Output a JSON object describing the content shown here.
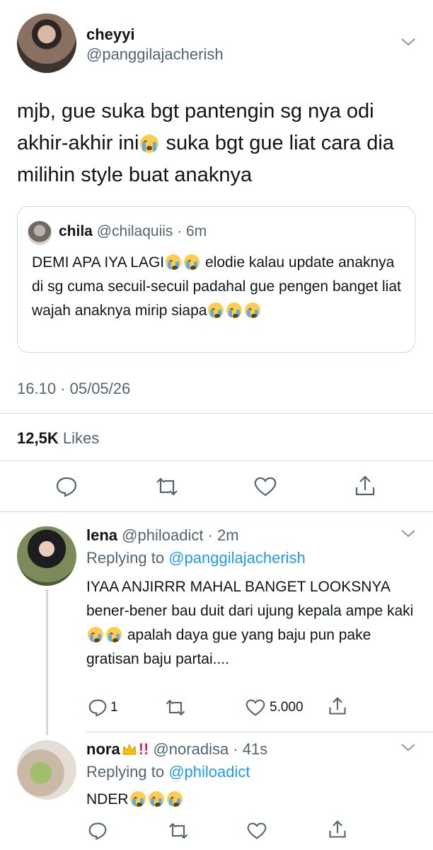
{
  "main_tweet": {
    "display_name": "cheyyi",
    "handle": "@panggilajacherish",
    "text_part1": "mjb, gue suka bgt pantengin sg nya odi akhir-akhir ini",
    "text_part2": " suka bgt gue liat cara dia milihin style buat anaknya",
    "quoted": {
      "display_name": "chila",
      "handle_time": "@chilaquiis · 6m",
      "text_part1": "DEMI APA IYA LAGI",
      "text_part2": " elodie kalau update anaknya di sg cuma secuil-secuil padahal gue pengen banget liat wajah anaknya mirip siapa"
    },
    "timestamp": "16.10 · 05/05/26",
    "likes_count": "12,5K",
    "likes_label": "Likes"
  },
  "replies": [
    {
      "display_name": "lena",
      "handle_time": "@philoadict · 2m",
      "replying_prefix": "Replying to",
      "replying_to": "@panggilajacherish",
      "text_part1": "IYAA ANJIRRR MAHAL BANGET LOOKSNYA bener-bener bau duit dari ujung kepala ampe kaki",
      "text_part2": " apalah daya gue yang baju pun pake gratisan baju partai....",
      "reply_count": "1",
      "like_count": "5.000"
    },
    {
      "display_name": "nora",
      "handle_time": "@noradisa · 41s",
      "replying_prefix": "Replying to",
      "replying_to": "@philoadict",
      "text_part1": "NDER",
      "exclaim": "!!"
    }
  ],
  "icons": {
    "reply": "reply-icon",
    "retweet": "retweet-icon",
    "like": "heart-icon",
    "share": "share-icon",
    "more": "chevron-down-icon",
    "emoji": "loudly-crying-face-emoji",
    "crown": "crown-emoji"
  },
  "colors": {
    "accent": "#1d9bf0",
    "secondary_text": "#536471",
    "divider": "#cfd9de"
  }
}
